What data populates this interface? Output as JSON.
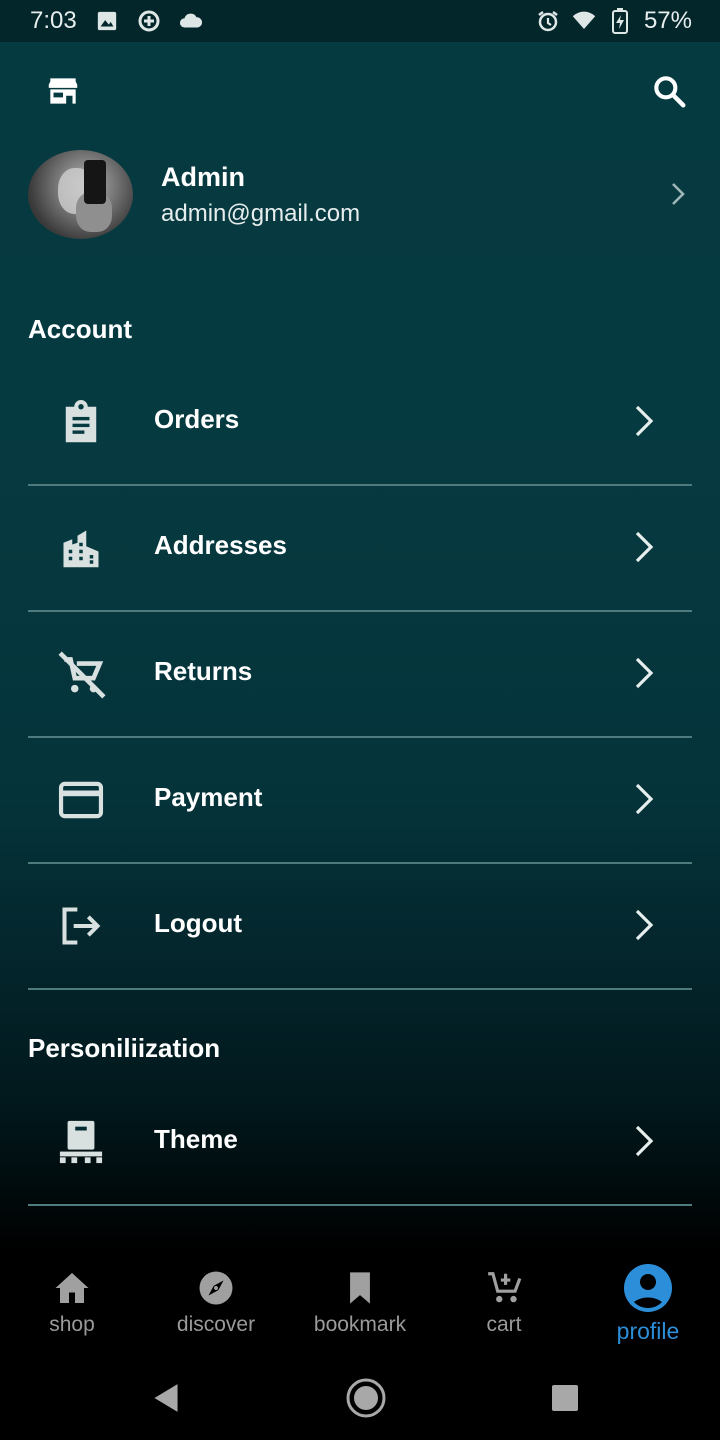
{
  "status_bar": {
    "time": "7:03",
    "battery": "57%",
    "icons_left": [
      "image-icon",
      "data-saver-icon",
      "cloud-icon"
    ],
    "icons_right": [
      "alarm-icon",
      "wifi-icon",
      "battery-charging-icon"
    ]
  },
  "app_bar": {
    "icons": [
      "store-icon",
      "search-icon"
    ]
  },
  "profile": {
    "name": "Admin",
    "email": "admin@gmail.com"
  },
  "sections": {
    "account_title": "Account",
    "personalization_title": "Personiliization"
  },
  "account_items": [
    {
      "label": "Orders",
      "icon": "clipboard-icon"
    },
    {
      "label": "Addresses",
      "icon": "building-icon"
    },
    {
      "label": "Returns",
      "icon": "remove-cart-icon"
    },
    {
      "label": "Payment",
      "icon": "credit-card-icon"
    },
    {
      "label": "Logout",
      "icon": "logout-icon"
    }
  ],
  "personalization_items": [
    {
      "label": "Theme",
      "icon": "theme-icon"
    }
  ],
  "bottom_nav": {
    "items": [
      {
        "label": "shop",
        "icon": "home-icon",
        "active": false
      },
      {
        "label": "discover",
        "icon": "compass-icon",
        "active": false
      },
      {
        "label": "bookmark",
        "icon": "bookmark-icon",
        "active": false
      },
      {
        "label": "cart",
        "icon": "add-cart-icon",
        "active": false
      },
      {
        "label": "profile",
        "icon": "account-circle-icon",
        "active": true
      }
    ]
  },
  "colors": {
    "background_top": "#053a40",
    "divider": "#4f7a7e",
    "active_accent": "#2c8ed8",
    "inactive_nav": "#9a9a9a"
  }
}
